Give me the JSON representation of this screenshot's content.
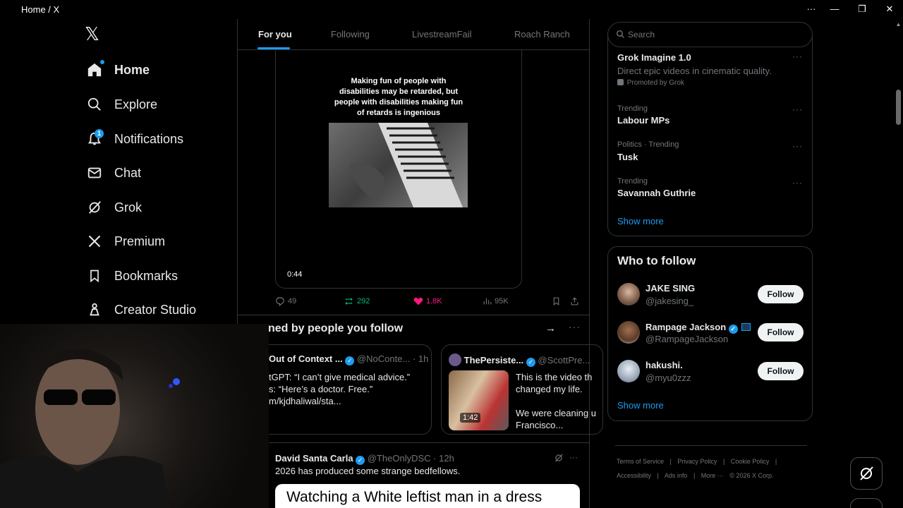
{
  "window": {
    "title": "Home / X",
    "more_glyph": "···",
    "minimize_glyph": "—",
    "maximize_glyph": "❐",
    "close_glyph": "✕"
  },
  "nav": {
    "logo": "𝕏",
    "items": [
      {
        "label": "Home",
        "icon": "home-icon"
      },
      {
        "label": "Explore",
        "icon": "search-icon"
      },
      {
        "label": "Notifications",
        "icon": "bell-icon",
        "badge": "1"
      },
      {
        "label": "Chat",
        "icon": "mail-icon"
      },
      {
        "label": "Grok",
        "icon": "grok-icon"
      },
      {
        "label": "Premium",
        "icon": "x-logo-icon"
      },
      {
        "label": "Bookmarks",
        "icon": "bookmark-icon"
      },
      {
        "label": "Creator Studio",
        "icon": "creator-icon"
      }
    ]
  },
  "tabs": [
    "For you",
    "Following",
    "LivestreamFail",
    "Roach Ranch"
  ],
  "video_post": {
    "caption": "Making fun of people with disabilities may be retarded, but people with disabilities making fun of retards is ingenious",
    "duration": "0:44",
    "replies": "49",
    "reposts": "292",
    "likes": "1.8K",
    "views": "95K"
  },
  "liked_section": {
    "header": "ned by people you follow",
    "arrow": "→",
    "more": "···",
    "cards": [
      {
        "name": "Out of Context ...",
        "handle": "@NoConte...",
        "time": "· 1h",
        "lines": [
          "tGPT: “I can’t give medical advice.”",
          "s: “Here’s a doctor. Free.”",
          "m/kjdhaliwal/sta..."
        ]
      },
      {
        "name": "ThePersiste...",
        "handle": "@ScottPre...",
        "thumb_duration": "1:42",
        "lines": [
          "This is the video th",
          "changed my life.",
          "",
          "We were cleaning u",
          "Francisco..."
        ]
      }
    ]
  },
  "bottom_post": {
    "name": "David Santa Carla",
    "handle": "@TheOnlyDSC",
    "time": "· 12h",
    "more": "···",
    "text": "2026 has produced some strange bedfellows.",
    "image_text": "Watching a White leftist man in a dress"
  },
  "search": {
    "placeholder": "Search"
  },
  "trends": {
    "promo_title": "Grok Imagine 1.0",
    "promo_desc": "Direct epic videos in cinematic quality.",
    "promo_label": "Promoted by Grok",
    "more": "···",
    "items": [
      {
        "meta": "Trending",
        "name": "Labour MPs"
      },
      {
        "meta": "Politics · Trending",
        "name": "Tusk"
      },
      {
        "meta": "Trending",
        "name": "Savannah Guthrie"
      }
    ],
    "show_more": "Show more"
  },
  "who_to_follow": {
    "title": "Who to follow",
    "users": [
      {
        "name": "JAKE SING",
        "handle": "@jakesing_",
        "button": "Follow"
      },
      {
        "name": "Rampage Jackson",
        "handle": "@RampageJackson",
        "button": "Follow"
      },
      {
        "name": "hakushi.",
        "handle": "@myu0zzz",
        "button": "Follow"
      }
    ],
    "show_more": "Show more"
  },
  "footer": {
    "row1": [
      "Terms of Service",
      "|",
      "Privacy Policy",
      "|",
      "Cookie Policy",
      "|"
    ],
    "row2": [
      "Accessibility",
      "|",
      "Ads info",
      "|",
      "More ···",
      "© 2026 X Corp."
    ]
  },
  "colors": {
    "accent": "#1d9bf0",
    "repost": "#00ba7c",
    "like": "#f91880",
    "border": "#2f3336",
    "muted": "#71767b"
  }
}
